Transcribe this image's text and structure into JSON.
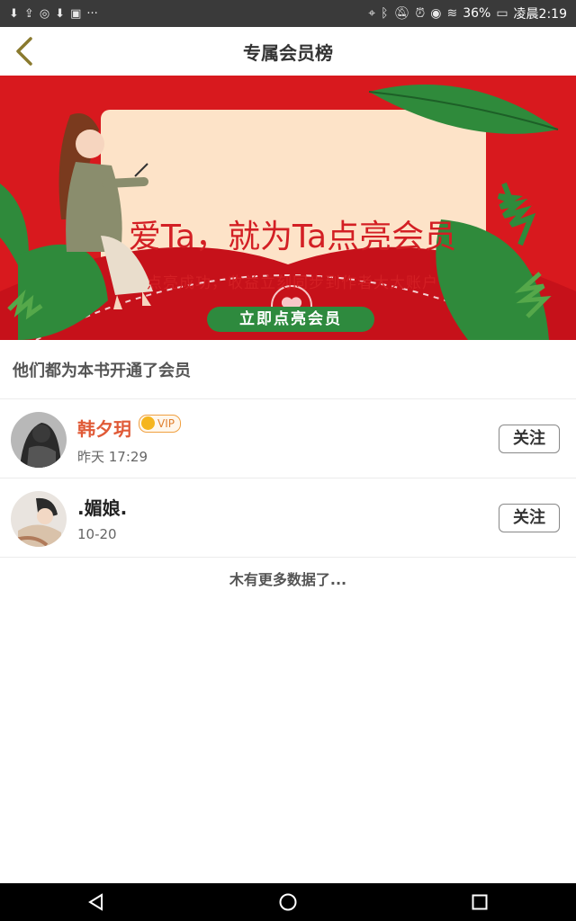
{
  "status_bar": {
    "left_icons": [
      "download-icon",
      "upload-icon",
      "sync-icon",
      "download-icon",
      "image-icon",
      "more-icon"
    ],
    "more_text": "···",
    "battery": "36%",
    "time": "凌晨2:19"
  },
  "header": {
    "title": "专属会员榜"
  },
  "banner": {
    "headline": "爱Ta，就为Ta点亮会员",
    "subtitle": "点亮成功，收益立刻同步到作者大大账户",
    "cta_label": "立即点亮会员"
  },
  "section": {
    "title": "他们都为本书开通了会员"
  },
  "members": [
    {
      "name": "韩夕玥",
      "vip": true,
      "vip_label": "VIP",
      "time": "昨天 17:29",
      "follow_label": "关注"
    },
    {
      "name": ".媚娘.",
      "vip": false,
      "time": "10-20",
      "follow_label": "关注"
    }
  ],
  "footer": {
    "no_more_text": "木有更多数据了..."
  },
  "colors": {
    "banner_red": "#d8191e",
    "cta_green": "#2e8a3e",
    "vip_name": "#e05a37"
  }
}
